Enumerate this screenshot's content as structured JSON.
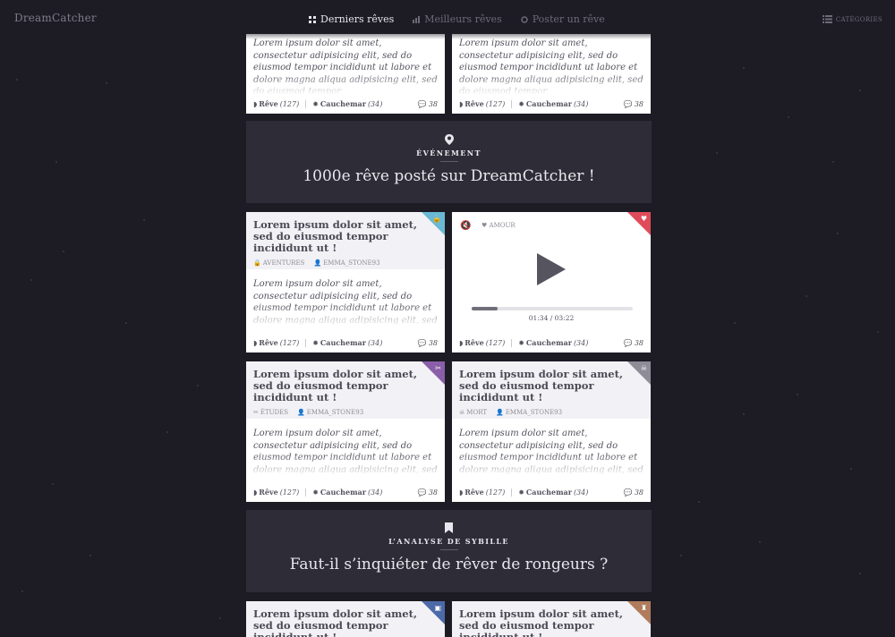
{
  "app": {
    "logo": "DreamCatcher"
  },
  "nav": {
    "items": [
      {
        "label": "Derniers rêves",
        "active": true
      },
      {
        "label": "Meilleurs rêves",
        "active": false
      },
      {
        "label": "Poster un rêve",
        "active": false
      }
    ],
    "categories": "CATÉGORIES"
  },
  "body_text": "Lorem ipsum dolor sit amet, consectetur adipisicing elit, sed do eiusmod tempor incididunt ut labore et dolore magna aliqua adipisicing elit, sed do eiusmod tempor incididunt ut labore et dolore",
  "top_body_text": "Lorem ipsum dolor sit amet, consectetur adipisicing elit, sed do eiusmod tempor incididunt ut labore et dolore magna aliqua adipisicing elit, sed do eiusmod tempor",
  "card_title": "Lorem ipsum dolor sit amet, sed do eiusmod tempor incididunt ut !",
  "footer": {
    "reve": "Rêve",
    "reve_count": "(127)",
    "cauchemar": "Cauchemar",
    "cauchemar_count": "(34)",
    "comments": "38"
  },
  "event1": {
    "kicker": "ÉVÉNEMENT",
    "title": "1000e rêve posté sur DreamCatcher !"
  },
  "event2": {
    "kicker": "L’ANALYSE DE SYBILLE",
    "title": "Faut-il s’inquiéter de rêver de rongeurs ?"
  },
  "cards": {
    "c1": {
      "category": "AVENTURES",
      "author": "EMMA_STONE93",
      "ribbon_color": "#6ab9d4"
    },
    "c2": {
      "tag": "AMOUR",
      "time": "01:34 / 03:22",
      "progress": 0.16,
      "ribbon_color": "#e04b5a"
    },
    "c3": {
      "category": "ÉTUDES",
      "author": "EMMA_STONE93",
      "ribbon_color": "#8a5ea8"
    },
    "c4": {
      "category": "MORT",
      "author": "EMMA_STONE93",
      "ribbon_color": "#8d8c97"
    },
    "c5": {
      "ribbon_color": "#4d6aa8"
    },
    "c6": {
      "ribbon_color": "#b07c5d"
    }
  }
}
